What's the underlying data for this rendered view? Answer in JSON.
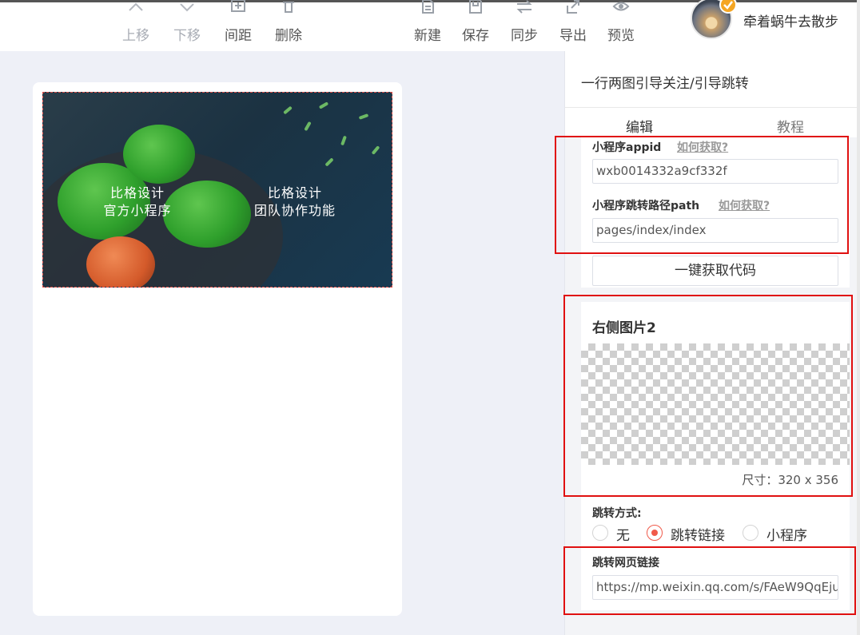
{
  "toolbar": {
    "move_up": "上移",
    "move_down": "下移",
    "spacing": "间距",
    "delete": "删除",
    "new": "新建",
    "save": "保存",
    "sync": "同步",
    "export": "导出",
    "preview": "预览"
  },
  "user": {
    "name": "牵着蜗牛去散步"
  },
  "banner": {
    "left_line1": "比格设计",
    "left_line2": "官方小程序",
    "right_line1": "比格设计",
    "right_line2": "团队协作功能"
  },
  "panel": {
    "title": "一行两图引导关注/引导跳转",
    "tabs": {
      "edit": "编辑",
      "tutorial": "教程"
    },
    "miniprogram": {
      "appid_label": "小程序appid",
      "appid_help": "如何获取?",
      "appid_value": "wxb0014332a9cf332f",
      "path_label": "小程序跳转路径path",
      "path_help": "如何获取?",
      "path_value": "pages/index/index",
      "get_code_button": "一键获取代码"
    },
    "right_image": {
      "title": "右侧图片2",
      "size_text": "尺寸：320 x 356"
    },
    "jump": {
      "label": "跳转方式:",
      "options": [
        "无",
        "跳转链接",
        "小程序"
      ],
      "selected": "跳转链接",
      "url_label": "跳转网页链接",
      "url_value": "https://mp.weixin.qq.com/s/FAeW9QqEju"
    }
  },
  "colors": {
    "accent": "#f05a4a",
    "highlight": "#e01010",
    "canvas_bg": "#eef0f7"
  }
}
